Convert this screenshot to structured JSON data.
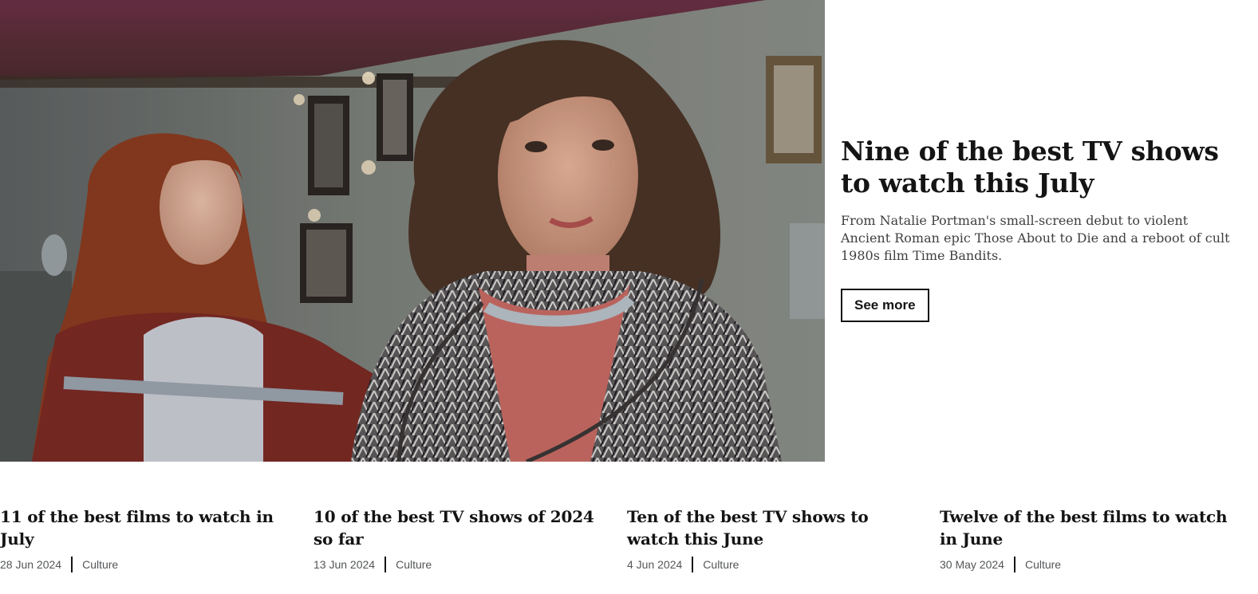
{
  "hero": {
    "title": "Nine of the best TV shows to watch this July",
    "summary": "From Natalie Portman's small-screen debut to violent Ancient Roman epic Those About to Die and a reboot of cult 1980s film Time Bandits.",
    "button_label": "See more",
    "image_icon": "hero-photo"
  },
  "cards": [
    {
      "title": "11 of the best films to watch in July",
      "date": "28 Jun 2024",
      "tag": "Culture"
    },
    {
      "title": "10 of the best TV shows of 2024 so far",
      "date": "13 Jun 2024",
      "tag": "Culture"
    },
    {
      "title": "Ten of the best TV shows to watch this June",
      "date": "4 Jun 2024",
      "tag": "Culture"
    },
    {
      "title": "Twelve of the best films to watch in June",
      "date": "30 May 2024",
      "tag": "Culture"
    }
  ]
}
